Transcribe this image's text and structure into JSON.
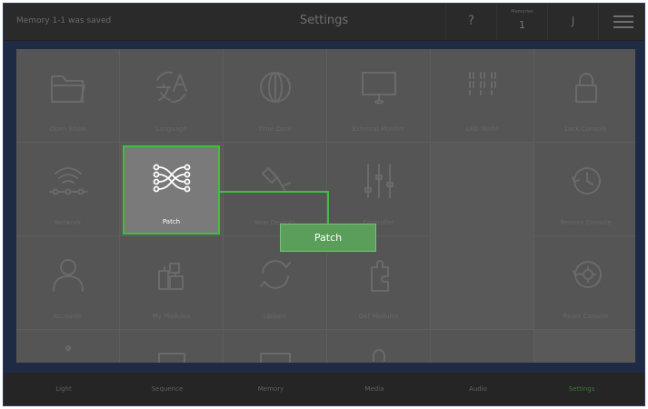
{
  "topbar": {
    "status": "Memory 1-1 was saved",
    "title": "Settings",
    "help": "?",
    "memories_label": "Memories",
    "memories_value": "1",
    "user": "J"
  },
  "tiles": {
    "open_show": "Open Show",
    "language": "Language",
    "time_zone": "Time Zone",
    "external_monitor": "External Monitor",
    "led_mode": "LED Mode",
    "lock_console": "Lock Console",
    "network": "Network",
    "patch": "Patch",
    "new_devices": "New Devices",
    "controller": "Controller",
    "restore_console": "Restore Console",
    "accounts": "Accounts",
    "my_modules": "My Modules",
    "update": "Update",
    "get_modules": "Get Modules",
    "reset_console": "Reset Console"
  },
  "tooltip": "Patch",
  "bottom_tabs": {
    "light": "Light",
    "sequence": "Sequence",
    "memory": "Memory",
    "media": "Media",
    "audio": "Audio",
    "settings": "Settings"
  },
  "icons": {
    "open_show": "folder-icon",
    "language": "translate-icon",
    "time_zone": "globe-icon",
    "external_monitor": "monitor-icon",
    "led_mode": "led-matrix-icon",
    "lock_console": "lock-icon",
    "network": "wifi-network-icon",
    "patch": "patch-cables-icon",
    "new_devices": "device-icon",
    "controller": "faders-icon",
    "restore_console": "clock-restore-icon",
    "accounts": "user-icon",
    "my_modules": "puzzle-modules-icon",
    "update": "refresh-icon",
    "get_modules": "puzzle-icon",
    "reset_console": "gear-reset-icon"
  },
  "colors": {
    "accent_green": "#3fbf3f",
    "tooltip_green": "#5a9e5a",
    "frame_blue": "#1f2a45"
  }
}
